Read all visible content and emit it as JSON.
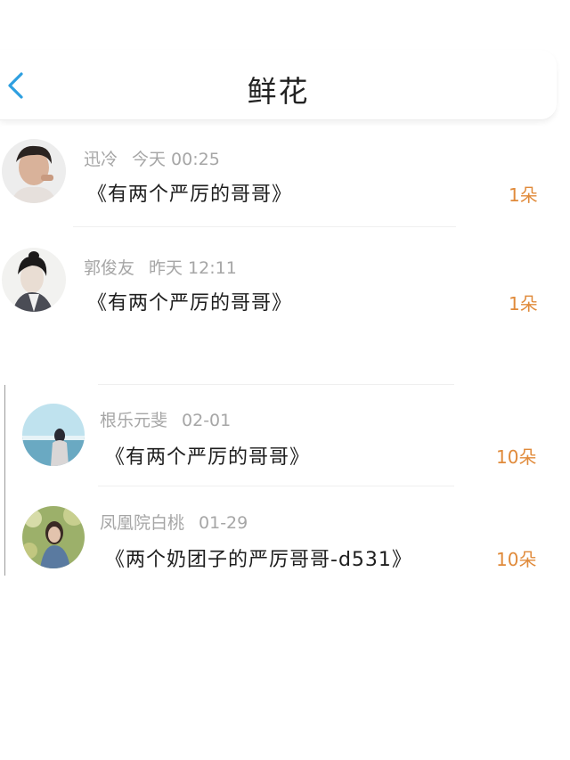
{
  "header": {
    "title": "鲜花",
    "back_icon": "chevron-left-icon",
    "accent_color": "#2e9fe0"
  },
  "colors": {
    "flower_count": "#e08a3a",
    "meta_text": "#a6a6a6"
  },
  "items": [
    {
      "user": "迅冷",
      "time": "今天 00:25",
      "book": "《有两个严厉的哥哥》",
      "count": "1朵"
    },
    {
      "user": "郭俊友",
      "time": "昨天 12:11",
      "book": "《有两个严厉的哥哥》",
      "count": "1朵"
    },
    {
      "user": "根乐元斐",
      "time": "02-01",
      "book": "《有两个严厉的哥哥》",
      "count": "10朵"
    },
    {
      "user": "凤凰院白桃",
      "time": "01-29",
      "book": "《两个奶团子的严厉哥哥-d531》",
      "count": "10朵"
    }
  ]
}
